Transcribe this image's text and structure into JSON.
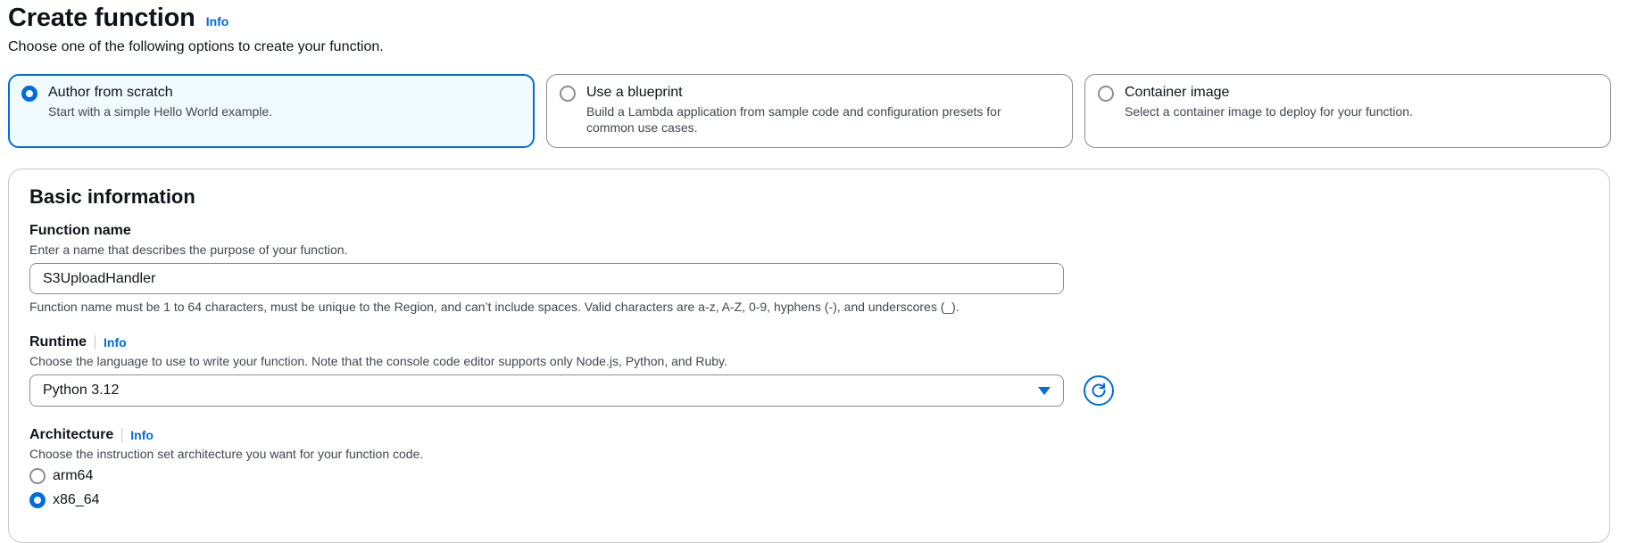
{
  "header": {
    "title": "Create function",
    "info": "Info",
    "subtitle": "Choose one of the following options to create your function."
  },
  "options": [
    {
      "title": "Author from scratch",
      "description": "Start with a simple Hello World example.",
      "selected": true
    },
    {
      "title": "Use a blueprint",
      "description": "Build a Lambda application from sample code and configuration presets for common use cases.",
      "selected": false
    },
    {
      "title": "Container image",
      "description": "Select a container image to deploy for your function.",
      "selected": false
    }
  ],
  "basic_info": {
    "heading": "Basic information",
    "function_name": {
      "label": "Function name",
      "description": "Enter a name that describes the purpose of your function.",
      "value": "S3UploadHandler",
      "constraint": "Function name must be 1 to 64 characters, must be unique to the Region, and can’t include spaces. Valid characters are a-z, A-Z, 0-9, hyphens (-), and underscores (_)."
    },
    "runtime": {
      "label": "Runtime",
      "info": "Info",
      "description": "Choose the language to use to write your function. Note that the console code editor supports only Node.js, Python, and Ruby.",
      "value": "Python 3.12"
    },
    "architecture": {
      "label": "Architecture",
      "info": "Info",
      "description": "Choose the instruction set architecture you want for your function code.",
      "options": [
        {
          "label": "arm64",
          "selected": false
        },
        {
          "label": "x86_64",
          "selected": true
        }
      ]
    }
  },
  "colors": {
    "accent": "#006ce0",
    "selected_bg": "#f0fbff",
    "text": "#0f141a",
    "secondary_text": "#424650",
    "border": "#8c8c94"
  },
  "icons": {
    "dropdown": "caret-down-icon",
    "refresh": "refresh-icon"
  }
}
